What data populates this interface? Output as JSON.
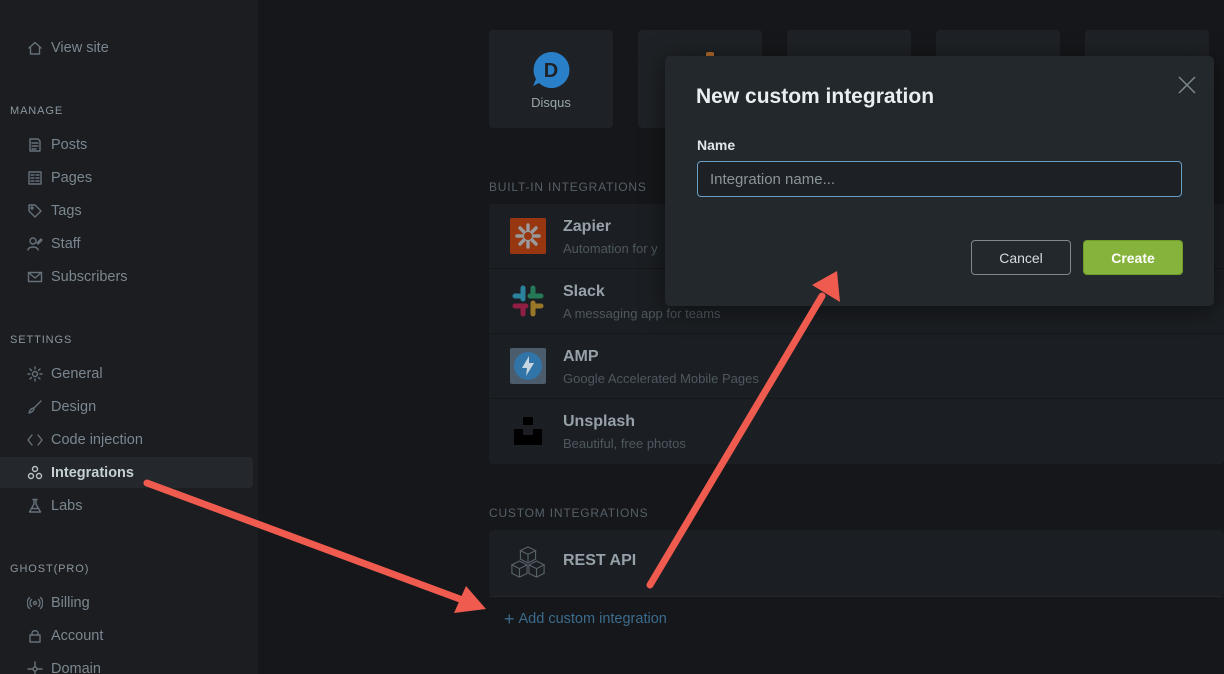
{
  "sidebar": {
    "view_site": "View site",
    "sections": {
      "manage": "MANAGE",
      "settings": "SETTINGS",
      "ghost_pro": "GHOST(PRO)"
    },
    "manage_items": [
      "Posts",
      "Pages",
      "Tags",
      "Staff",
      "Subscribers"
    ],
    "settings_items": [
      "General",
      "Design",
      "Code injection",
      "Integrations",
      "Labs"
    ],
    "ghost_items": [
      "Billing",
      "Account",
      "Domain"
    ],
    "active_item": "Integrations"
  },
  "main": {
    "apps": {
      "disqus": "Disqus"
    },
    "built_in_heading": "BUILT-IN INTEGRATIONS",
    "built_in": [
      {
        "title": "Zapier",
        "desc": "Automation for y"
      },
      {
        "title": "Slack",
        "desc": "A messaging app for teams"
      },
      {
        "title": "AMP",
        "desc": "Google Accelerated Mobile Pages"
      },
      {
        "title": "Unsplash",
        "desc": "Beautiful, free photos"
      }
    ],
    "custom_heading": "CUSTOM INTEGRATIONS",
    "rest_api": "REST API",
    "add_custom": "Add custom integration"
  },
  "modal": {
    "title": "New custom integration",
    "field_label": "Name",
    "input_placeholder": "Integration name...",
    "input_value": "",
    "cancel_label": "Cancel",
    "create_label": "Create"
  },
  "colors": {
    "accent_green": "#85b33b",
    "annotation_arrow": "#ef5b4f",
    "link_blue": "#3c6b8c"
  }
}
